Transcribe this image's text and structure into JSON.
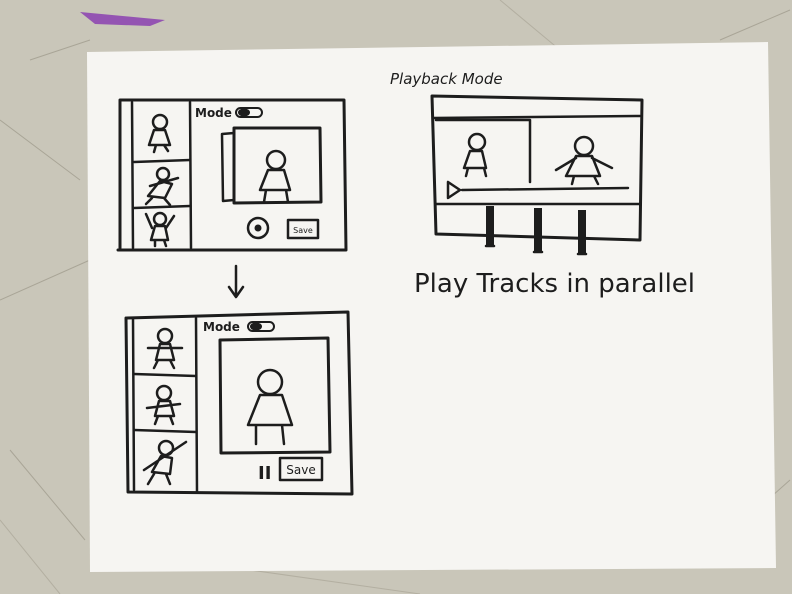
{
  "sketch1": {
    "mode_label": "Mode",
    "save_label": "Save"
  },
  "sketch2": {
    "mode_label": "Mode",
    "save_label": "Save",
    "pause_glyph": "II"
  },
  "playback": {
    "title": "Playback Mode",
    "caption": "Play Tracks in parallel"
  },
  "colors": {
    "paper": "#f6f5f2",
    "ink": "#1d1d1d",
    "desk": "#c9c6b9",
    "desk_smudge": "#8b3fb0"
  }
}
